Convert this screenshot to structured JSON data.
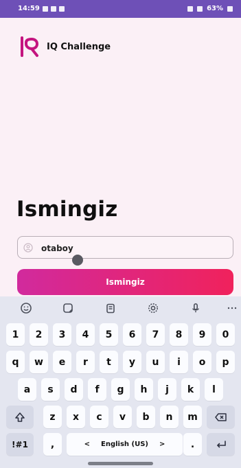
{
  "status_bar": {
    "time": "14:59",
    "battery": "63%"
  },
  "app": {
    "name": "IQ Challenge"
  },
  "screen": {
    "title": "Ismingiz"
  },
  "name_input": {
    "value": "otaboy"
  },
  "submit_button": {
    "label": "Ismingiz"
  },
  "keyboard": {
    "row_digits": [
      "1",
      "2",
      "3",
      "4",
      "5",
      "6",
      "7",
      "8",
      "9",
      "0"
    ],
    "row_top": [
      "q",
      "w",
      "e",
      "r",
      "t",
      "y",
      "u",
      "i",
      "o",
      "p"
    ],
    "row_mid": [
      "a",
      "s",
      "d",
      "f",
      "g",
      "h",
      "j",
      "k",
      "l"
    ],
    "row_bottom": [
      "z",
      "x",
      "c",
      "v",
      "b",
      "n",
      "m"
    ],
    "symbols_label": "!#1",
    "comma_label": ",",
    "space_label": "English (US)",
    "space_left_arrow": "<",
    "space_right_arrow": ">",
    "period_label": "."
  },
  "colors": {
    "status_bar": "#6e50b7",
    "background": "#fbf0f6",
    "button_gradient_start": "#d12a9d",
    "button_gradient_end": "#f0225c",
    "logo": "#c4147f"
  },
  "icons": {
    "toolbar": [
      "emoji-icon",
      "sticker-icon",
      "clipboard-icon",
      "settings-icon",
      "mic-icon",
      "more-icon"
    ]
  }
}
